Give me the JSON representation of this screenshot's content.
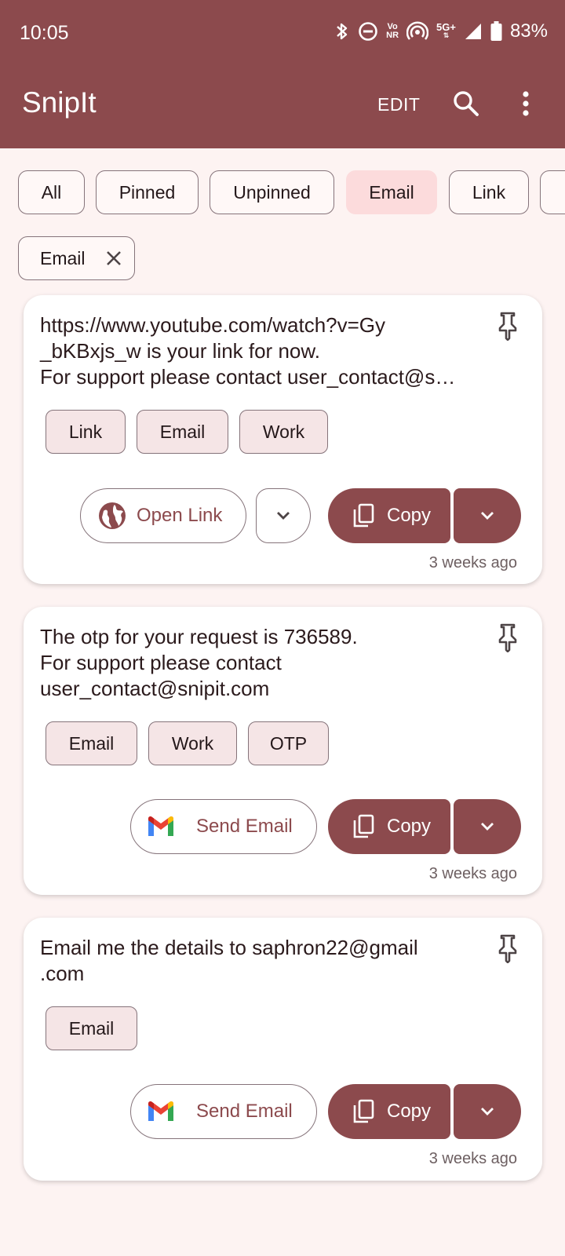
{
  "status_bar": {
    "time": "10:05",
    "vo_top": "Vo",
    "vo_bottom": "NR",
    "net_top": "5G+",
    "battery": "83%"
  },
  "app_bar": {
    "title": "SnipIt",
    "edit_label": "EDIT"
  },
  "filter_chips": [
    {
      "label": "All",
      "selected": false
    },
    {
      "label": "Pinned",
      "selected": false
    },
    {
      "label": "Unpinned",
      "selected": false
    },
    {
      "label": "Email",
      "selected": true
    },
    {
      "label": "Link",
      "selected": false
    }
  ],
  "active_filter": {
    "label": "Email"
  },
  "cards": [
    {
      "text": "https://www.youtube.com/watch?v=Gy\n_bKBxjs_w is your link for now.\nFor support please contact user_contact@s…",
      "tags": [
        "Link",
        "Email",
        "Work"
      ],
      "action_label": "Open Link",
      "copy_label": "Copy",
      "time": "3 weeks ago"
    },
    {
      "text": "The otp for your request is 736589.\nFor support please contact\nuser_contact@snipit.com",
      "tags": [
        "Email",
        "Work",
        "OTP"
      ],
      "action_label": "Send Email",
      "copy_label": "Copy",
      "time": "3 weeks ago"
    },
    {
      "text": "Email me the details to saphron22@gmail\n.com",
      "tags": [
        "Email"
      ],
      "action_label": "Send Email",
      "copy_label": "Copy",
      "time": "3 weeks ago"
    }
  ],
  "colors": {
    "primary": "#8c4a4d",
    "background": "#fdf3f2",
    "selected_chip": "#fcdbdc",
    "tag_bg": "#f5e5e6"
  }
}
